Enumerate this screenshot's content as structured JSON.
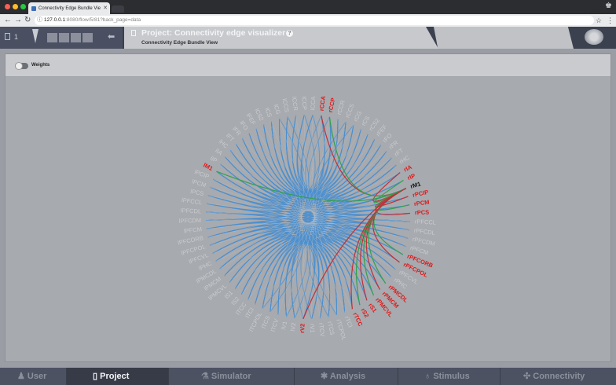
{
  "browser": {
    "tab_title": "Connectivity Edge Bundle Vie",
    "url_host": "127.0.0.1",
    "url_rest": ":8080/flow/5/81?back_page=data"
  },
  "header": {
    "project_number": "1",
    "title": "Project: Connectivity edge visualizer",
    "subtitle": "Connectivity Edge Bundle View"
  },
  "toolbar": {
    "weights_label": "Weights"
  },
  "graph": {
    "nodes": [
      "rCCA",
      "rCCP",
      "rCCR",
      "rCCS",
      "rCG",
      "rCS",
      "rCS2",
      "rFEF",
      "rFO",
      "rFR",
      "rFT",
      "rHC",
      "rIA",
      "rIP",
      "rM1",
      "rPCIP",
      "rPCM",
      "rPCS",
      "rPFCCL",
      "rPFCDL",
      "rPFCDM",
      "rPFCM",
      "rPFCORB",
      "rPFCPOL",
      "rPFCVL",
      "rPHC",
      "rPMCDL",
      "rPMCM",
      "rPMCVL",
      "rS1",
      "rS2",
      "rTCC",
      "rTCI",
      "rTCPOL",
      "rTCS",
      "rTCV",
      "rV1",
      "rV2",
      "lV2",
      "lV1",
      "lTCV",
      "lTCS",
      "lTCPOL",
      "lTCI",
      "lTCC",
      "lS2",
      "lS1",
      "lPMCVL",
      "lPMCM",
      "lPMCDL",
      "lPHC",
      "lPFCVL",
      "lPFCPOL",
      "lPFCORB",
      "lPFCM",
      "lPFCDM",
      "lPFCDL",
      "lPFCCL",
      "lPCS",
      "lPCM",
      "lPCIP",
      "lM1",
      "lIP",
      "lIA",
      "lHC",
      "lFT",
      "lFR",
      "lFO",
      "lFEF",
      "lCS2",
      "lCS",
      "lCG",
      "lCCS",
      "lCCR",
      "lCCP",
      "lCCA"
    ],
    "highlighted_nodes": [
      "rCCA",
      "rCCP",
      "rIA",
      "rIP",
      "rPCIP",
      "rPCM",
      "rPCS",
      "rPFCORB",
      "rPFCPOL",
      "rPMCDL",
      "rPMCM",
      "rPMCVL",
      "rS1",
      "rS2",
      "rTCC",
      "lM1",
      "rV2"
    ],
    "selected_node": "rM1",
    "colors": {
      "edge": "#4a8fd0",
      "out_edge": "#c0303a",
      "in_edge": "#33a04a",
      "label": "#c9cbce",
      "highlight": "#e01818",
      "selected": "#111111"
    }
  },
  "bottom_nav": [
    {
      "label": "User",
      "icon": "user-icon"
    },
    {
      "label": "Project",
      "icon": "document-icon"
    },
    {
      "label": "Simulator",
      "icon": "flask-icon"
    },
    {
      "label": "Analysis",
      "icon": "chart-icon"
    },
    {
      "label": "Stimulus",
      "icon": "bulb-icon"
    },
    {
      "label": "Connectivity",
      "icon": "network-icon"
    }
  ]
}
